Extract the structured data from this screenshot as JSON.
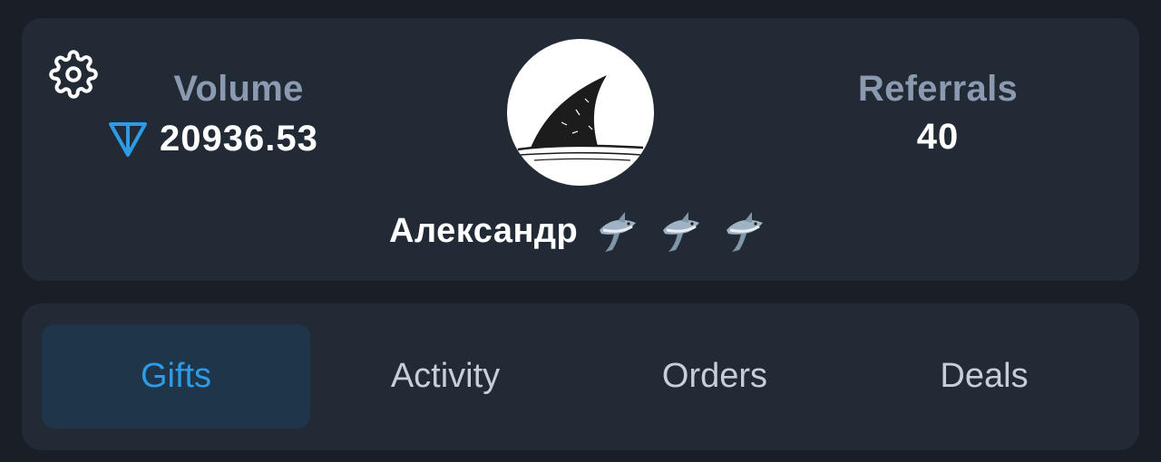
{
  "profile": {
    "volume": {
      "label": "Volume",
      "value": "20936.53",
      "currency_icon": "ton-icon"
    },
    "referrals": {
      "label": "Referrals",
      "value": "40"
    },
    "name": "Александр",
    "avatar_icon": "shark-fin-avatar",
    "badges": [
      "shark-emoji",
      "shark-emoji",
      "shark-emoji"
    ],
    "settings_icon": "gear-icon"
  },
  "tabs": [
    {
      "label": "Gifts",
      "active": true
    },
    {
      "label": "Activity",
      "active": false
    },
    {
      "label": "Orders",
      "active": false
    },
    {
      "label": "Deals",
      "active": false
    }
  ],
  "colors": {
    "background": "#1a1f27",
    "card": "#222a35",
    "accent": "#2d9be6",
    "active_tab_bg": "#1f3549",
    "label": "#8b9ab0"
  }
}
